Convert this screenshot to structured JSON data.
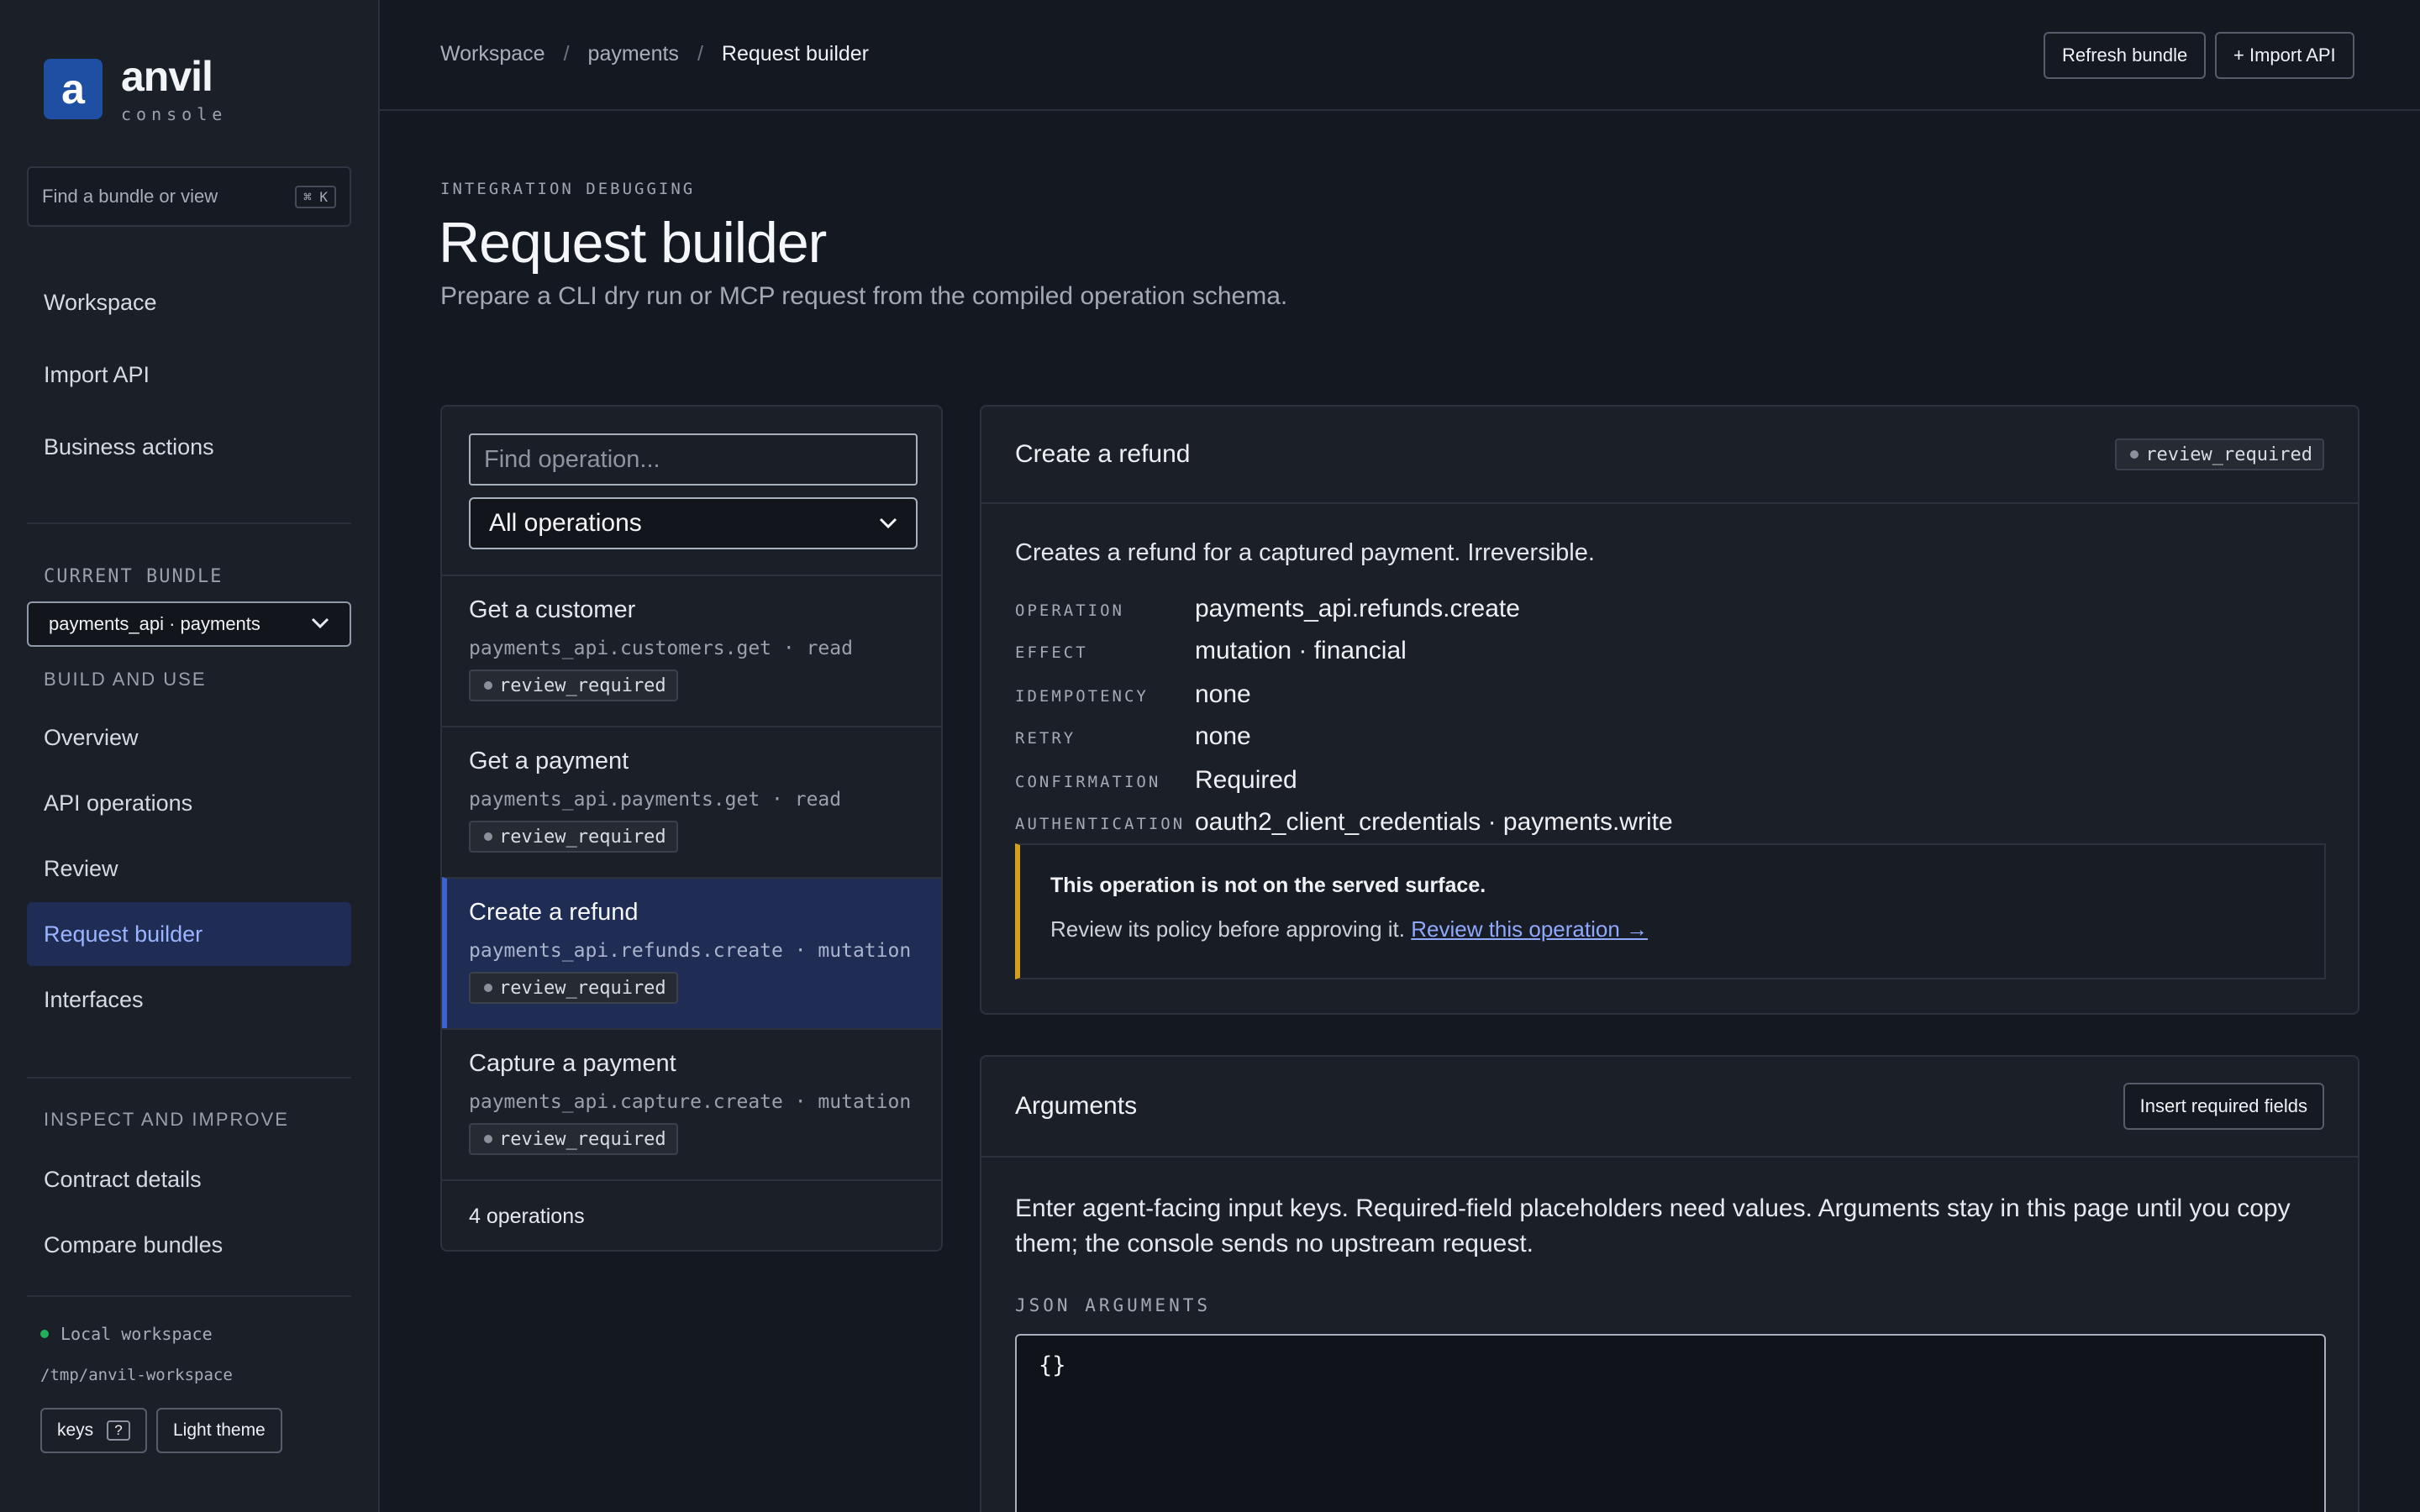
{
  "app": {
    "name": "anvil",
    "subtitle": "console",
    "logo_letter": "a"
  },
  "sidebar": {
    "search_placeholder": "Find a bundle or view",
    "search_shortcut": "⌘ K",
    "top_items": [
      {
        "label": "Workspace"
      },
      {
        "label": "Import API"
      },
      {
        "label": "Business actions"
      }
    ],
    "current_bundle_label": "CURRENT BUNDLE",
    "current_bundle_value": "payments_api · payments",
    "build_label": "BUILD AND USE",
    "build_items": [
      {
        "label": "Overview"
      },
      {
        "label": "API operations"
      },
      {
        "label": "Review"
      },
      {
        "label": "Request builder",
        "active": true
      },
      {
        "label": "Interfaces"
      }
    ],
    "inspect_label": "INSPECT AND IMPROVE",
    "inspect_items": [
      {
        "label": "Contract details"
      },
      {
        "label": "Compare bundles"
      }
    ],
    "workspace_status": "Local workspace",
    "workspace_path": "/tmp/anvil-workspace",
    "keys_button": "keys",
    "keys_shortcut": "?",
    "theme_button": "Light theme"
  },
  "header": {
    "breadcrumbs": [
      "Workspace",
      "payments",
      "Request builder"
    ],
    "separator": "/",
    "refresh_button": "Refresh bundle",
    "import_button": "+ Import API"
  },
  "page": {
    "eyebrow": "INTEGRATION DEBUGGING",
    "title": "Request builder",
    "subtitle": "Prepare a CLI dry run or MCP request from the compiled operation schema."
  },
  "operations": {
    "search_placeholder": "Find operation...",
    "filter_value": "All operations",
    "items": [
      {
        "title": "Get a customer",
        "sub": "payments_api.customers.get · read",
        "badge": "review_required"
      },
      {
        "title": "Get a payment",
        "sub": "payments_api.payments.get · read",
        "badge": "review_required"
      },
      {
        "title": "Create a refund",
        "sub": "payments_api.refunds.create · mutation",
        "badge": "review_required",
        "selected": true
      },
      {
        "title": "Capture a payment",
        "sub": "payments_api.capture.create · mutation",
        "badge": "review_required"
      }
    ],
    "count_label": "4 operations"
  },
  "detail": {
    "title": "Create a refund",
    "badge": "review_required",
    "description": "Creates a refund for a captured payment. Irreversible.",
    "fields": [
      {
        "key": "OPERATION",
        "value": "payments_api.refunds.create"
      },
      {
        "key": "EFFECT",
        "value": "mutation · financial"
      },
      {
        "key": "IDEMPOTENCY",
        "value": "none"
      },
      {
        "key": "RETRY",
        "value": "none"
      },
      {
        "key": "CONFIRMATION",
        "value": "Required"
      },
      {
        "key": "AUTHENTICATION",
        "value": "oauth2_client_credentials · payments.write"
      }
    ],
    "notice_title": "This operation is not on the served surface.",
    "notice_body": "Review its policy before approving it.",
    "notice_link": "Review this operation →",
    "notice_color": "#d29f1e"
  },
  "arguments": {
    "title": "Arguments",
    "insert_button": "Insert required fields",
    "help_text": "Enter agent-facing input keys. Required-field placeholders need values. Arguments stay in this page until you copy them; the console sends no upstream request.",
    "json_label": "JSON ARGUMENTS",
    "json_value": "{}"
  },
  "colors": {
    "accent": "#1f4fa3",
    "active_nav": "#1f2c54",
    "active_text": "#9bb4ff",
    "link": "#8fa9ff",
    "status_ok": "#22b05c"
  }
}
